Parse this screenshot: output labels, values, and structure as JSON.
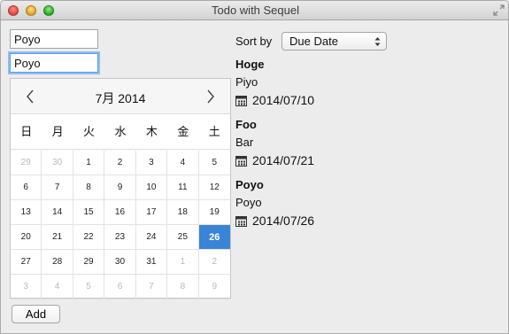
{
  "window": {
    "title": "Todo with Sequel"
  },
  "form": {
    "title_value": "Poyo",
    "detail_value": "Poyo",
    "add_label": "Add"
  },
  "calendar": {
    "month_label": "7月 2014",
    "weekdays": [
      "日",
      "月",
      "火",
      "水",
      "木",
      "金",
      "土"
    ],
    "days": [
      {
        "label": "29",
        "muted": true
      },
      {
        "label": "30",
        "muted": true
      },
      {
        "label": "1"
      },
      {
        "label": "2"
      },
      {
        "label": "3"
      },
      {
        "label": "4"
      },
      {
        "label": "5"
      },
      {
        "label": "6"
      },
      {
        "label": "7"
      },
      {
        "label": "8"
      },
      {
        "label": "9"
      },
      {
        "label": "10"
      },
      {
        "label": "11"
      },
      {
        "label": "12"
      },
      {
        "label": "13"
      },
      {
        "label": "14"
      },
      {
        "label": "15"
      },
      {
        "label": "16"
      },
      {
        "label": "17"
      },
      {
        "label": "18"
      },
      {
        "label": "19"
      },
      {
        "label": "20"
      },
      {
        "label": "21"
      },
      {
        "label": "22"
      },
      {
        "label": "23"
      },
      {
        "label": "24"
      },
      {
        "label": "25"
      },
      {
        "label": "26",
        "selected": true
      },
      {
        "label": "27"
      },
      {
        "label": "28"
      },
      {
        "label": "29"
      },
      {
        "label": "30"
      },
      {
        "label": "31"
      },
      {
        "label": "1",
        "muted": true
      },
      {
        "label": "2",
        "muted": true
      },
      {
        "label": "3",
        "muted": true
      },
      {
        "label": "4",
        "muted": true
      },
      {
        "label": "5",
        "muted": true
      },
      {
        "label": "6",
        "muted": true
      },
      {
        "label": "7",
        "muted": true
      },
      {
        "label": "8",
        "muted": true
      },
      {
        "label": "9",
        "muted": true
      }
    ],
    "selected_color": "#3a84d8"
  },
  "sort": {
    "label": "Sort by",
    "selected": "Due Date"
  },
  "todos": [
    {
      "title": "Hoge",
      "detail": "Piyo",
      "due": "2014/07/10"
    },
    {
      "title": "Foo",
      "detail": "Bar",
      "due": "2014/07/21"
    },
    {
      "title": "Poyo",
      "detail": "Poyo",
      "due": "2014/07/26"
    }
  ],
  "icons": [
    "close-icon",
    "minimize-icon",
    "zoom-icon",
    "fullscreen-icon",
    "chevron-left-icon",
    "chevron-right-icon",
    "calendar-icon",
    "select-arrows-icon"
  ]
}
